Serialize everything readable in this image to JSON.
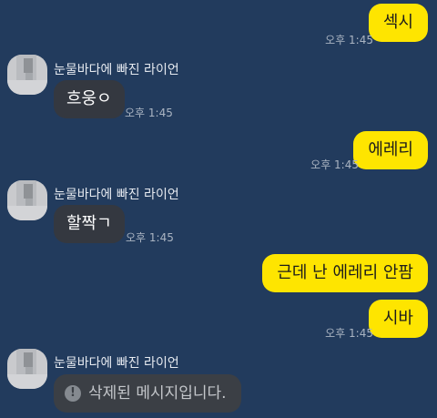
{
  "chat": {
    "messages": [
      {
        "direction": "out",
        "text": "섹시",
        "time": "오후 1:45"
      },
      {
        "direction": "in",
        "sender": "눈물바다에 빠진 라이언",
        "text": "흐웅ㅇ",
        "time": "오후 1:45"
      },
      {
        "direction": "out",
        "text": "에레리",
        "time": "오후 1:45"
      },
      {
        "direction": "in",
        "sender": "눈물바다에 빠진 라이언",
        "text": "할짝ㄱ",
        "time": "오후 1:45"
      },
      {
        "direction": "out",
        "text": "근데 난 에레리 안팜"
      },
      {
        "direction": "out",
        "text": "시바",
        "time": "오후 1:45"
      },
      {
        "direction": "in",
        "sender": "눈물바다에 빠진 라이언",
        "text": "삭제된 메시지입니다.",
        "deleted": true
      }
    ]
  },
  "icons": {
    "deleted_notice": "exclamation-circle-icon",
    "deleted_glyph": "!"
  },
  "colors": {
    "background": "#223b5d",
    "outgoing_bubble": "#fee500",
    "incoming_bubble": "#343840",
    "deleted_bubble": "#3b3f45",
    "timestamp": "#aab4c2"
  }
}
